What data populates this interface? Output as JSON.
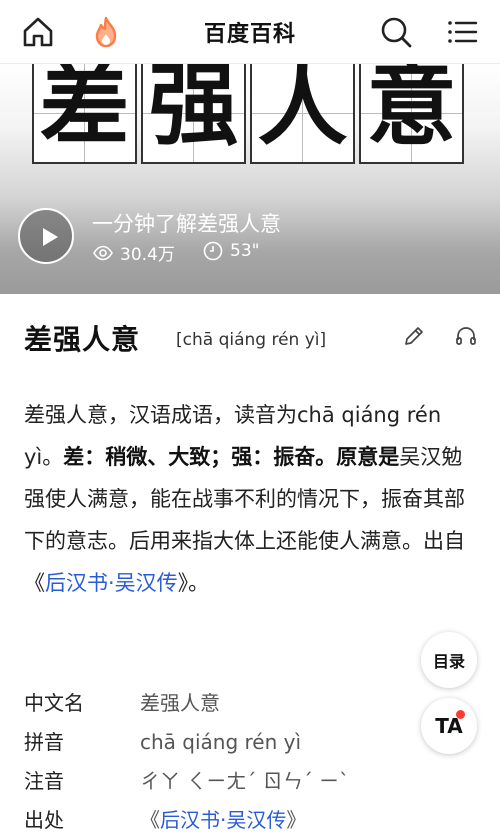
{
  "header": {
    "brand": "百度百科",
    "icons": [
      "home-icon",
      "flame-icon",
      "search-icon",
      "menu-icon"
    ],
    "accent_color": "#ff7a45"
  },
  "video": {
    "characters": [
      "差",
      "强",
      "人",
      "意"
    ],
    "title": "一分钟了解差强人意",
    "views": "30.4万",
    "duration": "53\""
  },
  "entry": {
    "title": "差强人意",
    "pinyin": "[chā qiáng rén yì]"
  },
  "summary": {
    "intro": "差强人意，汉语成语，读音为chā qiáng rén yì。",
    "bold_def": "差：稍微、大致；强：振奋。原意是",
    "rest": "吴汉勉强使人满意，能在战事不利的情况下，振奋其部下的意志。后用来指大体上还能使人满意。出自《",
    "link_book": "后汉书",
    "link_tail": "·吴汉传",
    "end": "》。",
    "link_color": "#2a5bd7"
  },
  "info": {
    "rows": [
      {
        "label": "中文名",
        "value": "差强人意"
      },
      {
        "label": "拼音",
        "value": "chā qiáng rén yì"
      },
      {
        "label": "注音",
        "value": "ㄔㄚ ㄑㄧㄤˊ ㄖㄣˊ ㄧˋ"
      }
    ],
    "source_label": "出处",
    "source_open": "《",
    "source_link": "后汉书",
    "source_tail": "·吴汉传",
    "source_close": "》"
  },
  "fab": {
    "toc": "目录",
    "ta": "TA"
  }
}
